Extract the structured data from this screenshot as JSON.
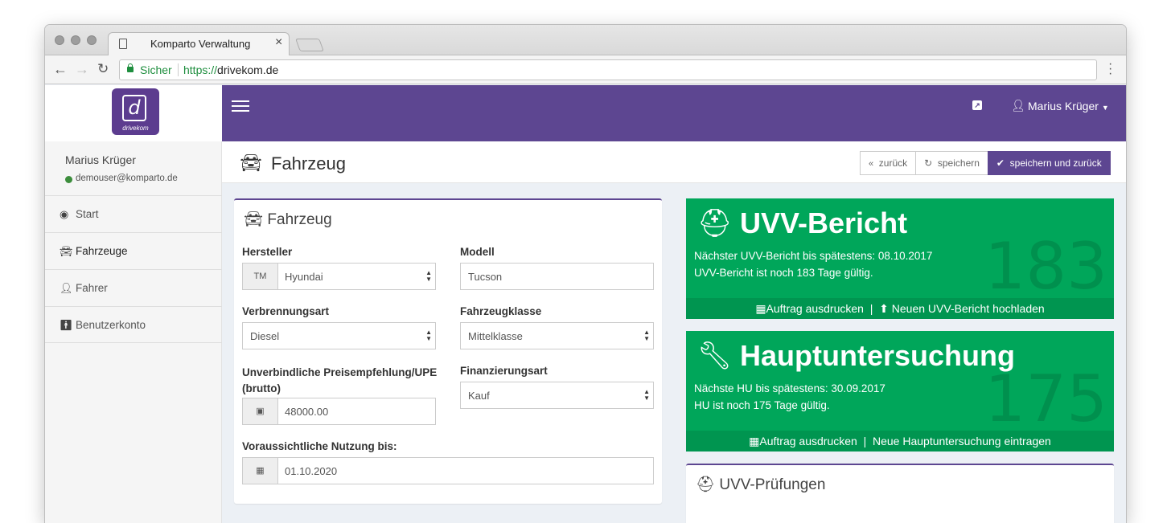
{
  "browser": {
    "tab_title": "Komparto Verwaltung",
    "tab_close": "×",
    "secure_label": "Sicher",
    "url_protocol": "https://",
    "url_host": "drivekom.de"
  },
  "sidebar": {
    "logo_text": "drivekom",
    "logo_letter": "d",
    "user_name": "Marius Krüger",
    "user_email": "demouser@komparto.de",
    "items": [
      {
        "label": "Start",
        "icon": "dashboard-icon"
      },
      {
        "label": "Fahrzeuge",
        "icon": "car-icon"
      },
      {
        "label": "Fahrer",
        "icon": "user-icon"
      },
      {
        "label": "Benutzerkonto",
        "icon": "person-icon"
      }
    ]
  },
  "topbar": {
    "user_menu": "Marius Krüger"
  },
  "page": {
    "title": "Fahrzeug",
    "btn_back": "zurück",
    "btn_save": "speichern",
    "btn_save_back": "speichern und zurück"
  },
  "vehicle_form": {
    "title": "Fahrzeug",
    "manufacturer_label": "Hersteller",
    "manufacturer_addon": "TM",
    "manufacturer_value": "Hyundai",
    "model_label": "Modell",
    "model_value": "Tucson",
    "fuel_label": "Verbrennungsart",
    "fuel_value": "Diesel",
    "class_label": "Fahrzeugklasse",
    "class_value": "Mittelklasse",
    "price_label": "Unverbindliche Preisempfehlung/UPE (brutto)",
    "price_value": "48000.00",
    "financing_label": "Finanzierungsart",
    "financing_value": "Kauf",
    "usage_label": "Voraussichtliche Nutzung bis:",
    "usage_value": "01.10.2020"
  },
  "uvv_report": {
    "title": "UVV-Bericht",
    "days": "183",
    "line1": "Nächster UVV-Bericht bis spätestens: 08.10.2017",
    "line2": "UVV-Bericht ist noch 183 Tage gültig.",
    "action_print": "Auftrag ausdrucken",
    "action_upload": "Neuen UVV-Bericht hochladen",
    "separator": "|"
  },
  "main_inspection": {
    "title": "Hauptuntersuchung",
    "days": "175",
    "line1": "Nächste HU bis spätestens: 30.09.2017",
    "line2": "HU ist noch 175 Tage gültig.",
    "action_print": "Auftrag ausdrucken",
    "action_add": "Neue Hauptuntersuchung eintragen",
    "separator": "|"
  },
  "uvv_checks": {
    "title": "UVV-Prüfungen"
  },
  "colors": {
    "brand": "#5d4691",
    "success": "#00a65a"
  }
}
